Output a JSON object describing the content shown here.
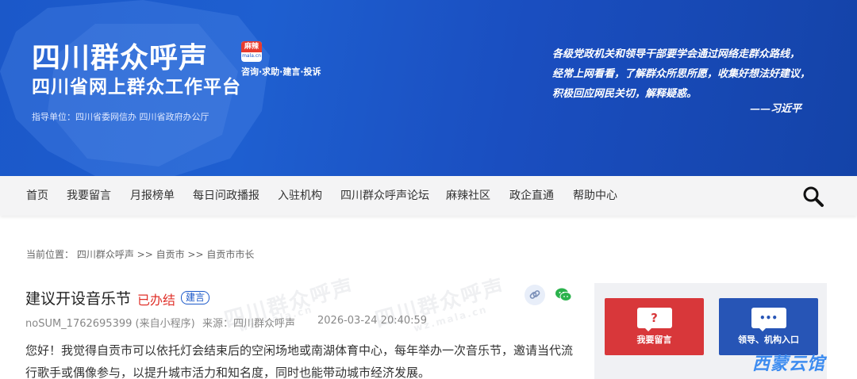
{
  "banner": {
    "title": "四川群众呼声",
    "subtitle": "四川省网上群众工作平台",
    "logo_text": "麻辣",
    "logo_domain": "mala.cn",
    "tags": "咨询·求助·建言·投诉",
    "guide": "指导单位：四川省委网信办 四川省政府办公厅",
    "quote_lines": [
      "各级党政机关和领导干部要学会通过网络走群众路线，",
      "经常上网看看，了解群众所思所愿，收集好想法好建议，",
      "积极回应网民关切，解释疑惑。"
    ],
    "quote_author": "——习近平",
    "colors": {
      "primary": "#1b58c9",
      "accent_red": "#e83b2e"
    }
  },
  "nav": {
    "items": [
      {
        "label": "首页"
      },
      {
        "label": "我要留言"
      },
      {
        "label": "月报榜单"
      },
      {
        "label": "每日问政播报"
      },
      {
        "label": "入驻机构"
      },
      {
        "label": "四川群众呼声论坛"
      },
      {
        "label": "麻辣社区"
      },
      {
        "label": "政企直通"
      },
      {
        "label": "帮助中心"
      }
    ],
    "search_icon": "search-icon"
  },
  "breadcrumb": {
    "prefix": "当前位置：",
    "path": "四川群众呼声 >> 自贡市 >> 自贡市市长"
  },
  "post": {
    "title": "建议开设音乐节",
    "status": "已办结",
    "tag": "建言",
    "author": "noSUM_1762695399 (来自小程序)",
    "source": "来源：四川群众呼声",
    "datetime": "2026-03-24 20:40:59",
    "body": "您好！我觉得自贡市可以依托灯会结束后的空闲场地或南湖体育中心，每年举办一次音乐节，邀请当代流行歌手或偶像参与，以提升城市活力和知名度，同时也能带动城市经济发展。",
    "colors": {
      "status": "#e0312a",
      "tag": "#1b58c9"
    }
  },
  "sidebar": {
    "cards": [
      {
        "label": "我要留言",
        "symbol": "?"
      },
      {
        "label": "领导、机构入口",
        "symbol": "•••"
      }
    ]
  },
  "watermark": {
    "text": "四川群众呼声",
    "domain": "wz.mala.cn"
  },
  "corner_mark": "西蒙云馆"
}
